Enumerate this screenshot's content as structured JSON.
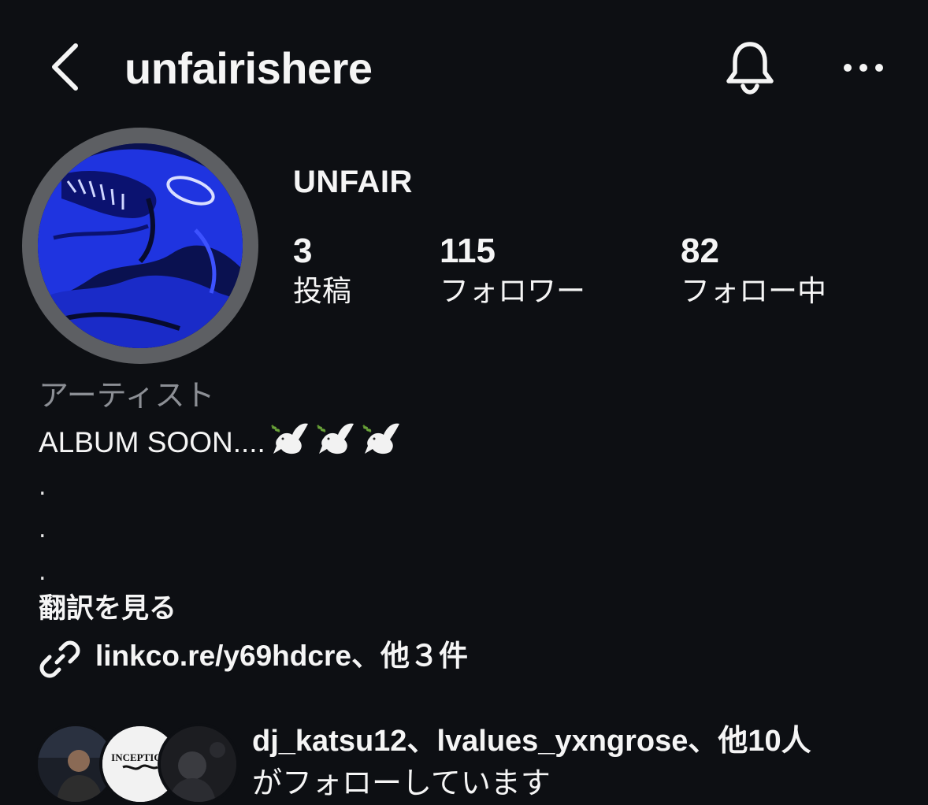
{
  "header": {
    "username": "unfairishere",
    "back_icon": "chevron-left-icon",
    "bell_icon": "bell-icon",
    "more_icon": "more-horizontal-icon"
  },
  "profile": {
    "display_name": "UNFAIR",
    "stats": {
      "posts": {
        "value": "3",
        "label": "投稿"
      },
      "followers": {
        "value": "115",
        "label": "フォロワー"
      },
      "following": {
        "value": "82",
        "label": "フォロー中"
      }
    }
  },
  "bio": {
    "category": "アーティスト",
    "text": "ALBUM SOON....",
    "emoji": "dove-icon",
    "dots": [
      ".",
      ".",
      "."
    ],
    "translate_label": "翻訳を見る",
    "link_text": "linkco.re/y69hdcre、他３件"
  },
  "followed_by": {
    "line1": "dj_katsu12、lvalues_yxngrose、他10人",
    "line2": "がフォローしています",
    "avatar2_text": "INCEPTION"
  },
  "colors": {
    "background": "#0d0f13",
    "text": "#f5f5f5",
    "muted": "#8c8f95",
    "avatar_blue": "#1f34e0",
    "ring": "#5d5f63"
  }
}
